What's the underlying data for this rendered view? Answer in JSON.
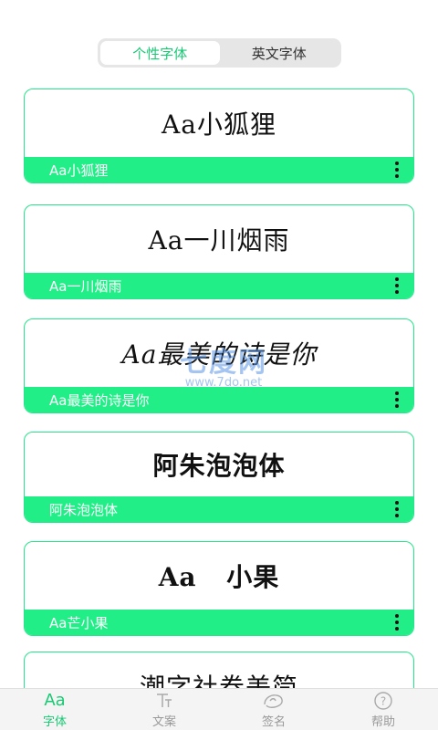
{
  "segment": {
    "tabs": [
      {
        "label": "个性字体",
        "active": true
      },
      {
        "label": "英文字体",
        "active": false
      }
    ]
  },
  "fonts": [
    {
      "preview": "Aa小狐狸",
      "name": "Aa小狐狸"
    },
    {
      "preview": "Aa一川烟雨",
      "name": "Aa一川烟雨"
    },
    {
      "preview": "Aa最美的诗是你",
      "name": "Aa最美的诗是你"
    },
    {
      "preview": "阿朱泡泡体",
      "name": "阿朱泡泡体"
    },
    {
      "preview": "Aa 小果",
      "name": "Aa芒小果"
    },
    {
      "preview": "潮字社卷美简",
      "name": ""
    }
  ],
  "watermark": {
    "logo": "七度网",
    "url": "www.7do.net"
  },
  "tabbar": {
    "items": [
      {
        "icon": "font-aa-icon",
        "glyph": "Aa",
        "label": "字体",
        "active": true
      },
      {
        "icon": "text-format-icon",
        "glyph": "T",
        "label": "文案",
        "active": false
      },
      {
        "icon": "signature-icon",
        "glyph": "",
        "label": "签名",
        "active": false
      },
      {
        "icon": "help-icon",
        "glyph": "?",
        "label": "帮助",
        "active": false
      }
    ]
  },
  "colors": {
    "accent": "#22ee88",
    "accent_text": "#19c974"
  }
}
